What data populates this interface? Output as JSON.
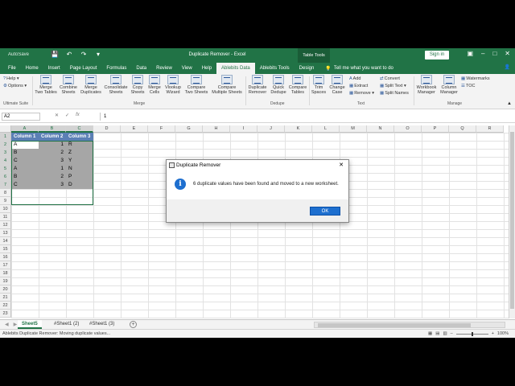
{
  "window": {
    "autosave": "AutoSave",
    "title": "Duplicate Remover  -  Excel",
    "context_tab_group": "Table Tools",
    "sign_in": "Sign in"
  },
  "tabs": [
    "File",
    "Home",
    "Insert",
    "Page Layout",
    "Formulas",
    "Data",
    "Review",
    "View",
    "Help",
    "Ablebits Data",
    "Ablebits Tools",
    "Design"
  ],
  "active_tab": "Ablebits Data",
  "tell_me": "Tell me what you want to do",
  "ribbon": {
    "help": "Help",
    "options": "Options",
    "ultimate_suite": "Ultimate Suite",
    "merge_two_tables": [
      "Merge",
      "Two Tables"
    ],
    "combine_sheets": [
      "Combine",
      "Sheets"
    ],
    "merge_duplicates": [
      "Merge",
      "Duplicates"
    ],
    "consolidate_sheets": [
      "Consolidate",
      "Sheets"
    ],
    "copy_sheets": [
      "Copy",
      "Sheets"
    ],
    "merge_cells": [
      "Merge",
      "Cells"
    ],
    "vlookup_wizard": [
      "Vlookup",
      "Wizard"
    ],
    "compare_two_sheets": [
      "Compare",
      "Two Sheets"
    ],
    "compare_multiple_sheets": [
      "Compare",
      "Multiple Sheets"
    ],
    "group_merge": "Merge",
    "duplicate_remover": [
      "Duplicate",
      "Remover"
    ],
    "quick_dedupe": [
      "Quick",
      "Dedupe"
    ],
    "compare_tables": [
      "Compare",
      "Tables"
    ],
    "group_dedupe": "Dedupe",
    "trim_spaces": [
      "Trim",
      "Spaces"
    ],
    "change_case": [
      "Change",
      "Case"
    ],
    "add": "Add",
    "extract": "Extract",
    "remove": "Remove",
    "convert": "Convert",
    "split_text": "Split Text",
    "split_names": "Split Names",
    "group_text": "Text",
    "workbook_manager": [
      "Workbook",
      "Manager"
    ],
    "column_manager": [
      "Column",
      "Manager"
    ],
    "watermarks": "Watermarks",
    "toc": "TOC",
    "group_manage": "Manage"
  },
  "formula_bar": {
    "name_box": "A2",
    "fx": "fx",
    "value": "1"
  },
  "columns": [
    "A",
    "B",
    "C",
    "D",
    "E",
    "F",
    "G",
    "H",
    "I",
    "J",
    "K",
    "L",
    "M",
    "N",
    "O",
    "P",
    "Q",
    "R"
  ],
  "rows": [
    "1",
    "2",
    "3",
    "4",
    "5",
    "6",
    "7",
    "8",
    "9",
    "10",
    "11",
    "12",
    "13",
    "14",
    "15",
    "16",
    "17",
    "18",
    "19",
    "20",
    "21",
    "22",
    "23"
  ],
  "table": {
    "headers": [
      "Column 1",
      "Column 2",
      "Column 3"
    ],
    "rows": [
      [
        "A",
        "1",
        "R"
      ],
      [
        "B",
        "2",
        "Z"
      ],
      [
        "C",
        "3",
        "Y"
      ],
      [
        "A",
        "1",
        "N"
      ],
      [
        "B",
        "2",
        "P"
      ],
      [
        "C",
        "3",
        "D"
      ]
    ]
  },
  "dialog": {
    "title": "Duplicate Remover",
    "message": "6 duplicate values have been found and moved to a new worksheet.",
    "ok": "OK"
  },
  "sheets": [
    "Sheet5",
    "#Sheet1 (2)",
    "#Sheet1 (3)"
  ],
  "active_sheet": "Sheet5",
  "status": {
    "text": "Ablebits Duplicate Remover: Moving duplicate values...",
    "zoom": "100%"
  },
  "colors": {
    "excel_green": "#217346",
    "table_header": "#5b7fb5",
    "dialog_button": "#1e6fcf"
  }
}
